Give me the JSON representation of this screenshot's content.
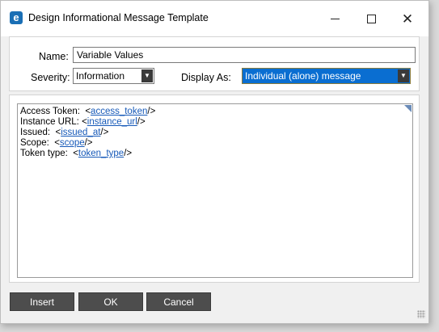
{
  "window": {
    "title": "Design Informational Message Template",
    "app_icon_letter": "e"
  },
  "form": {
    "name_label": "Name:",
    "name_value": "Variable Values",
    "severity_label": "Severity:",
    "severity_value": "Information",
    "display_label": "Display As:",
    "display_value": "Individual (alone) message"
  },
  "editor": {
    "lines": [
      {
        "label": "Access Token:  <",
        "token": "access_token",
        "suffix": "/>"
      },
      {
        "label": "Instance URL: <",
        "token": "instance_url",
        "suffix": "/>"
      },
      {
        "label": "Issued:  <",
        "token": "issued_at",
        "suffix": "/>"
      },
      {
        "label": "Scope:  <",
        "token": "scope",
        "suffix": "/>"
      },
      {
        "label": "Token type:  <",
        "token": "token_type",
        "suffix": "/>"
      }
    ]
  },
  "buttons": {
    "insert": "Insert",
    "ok": "OK",
    "cancel": "Cancel"
  },
  "colors": {
    "selected_dropdown": "#0a6ed1",
    "link_token": "#1659b8",
    "button_bg": "#4d4d4d"
  }
}
